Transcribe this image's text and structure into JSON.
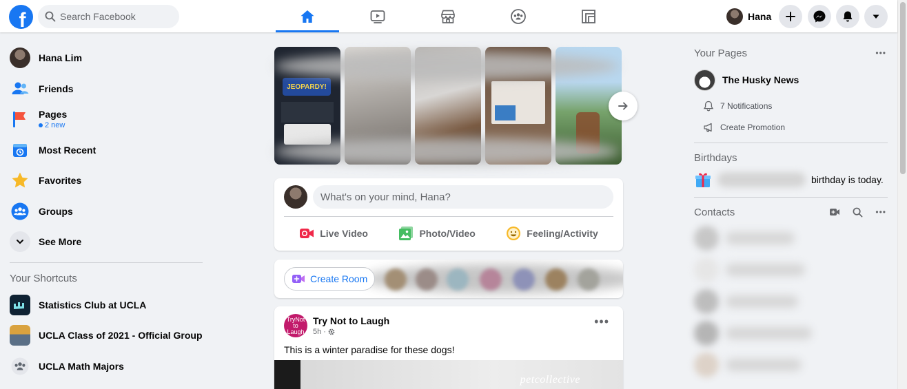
{
  "topbar": {
    "logo": "f",
    "search_placeholder": "Search Facebook",
    "tabs": [
      {
        "name": "home",
        "icon": "home-icon",
        "active": true
      },
      {
        "name": "watch",
        "icon": "video-icon",
        "active": false
      },
      {
        "name": "marketplace",
        "icon": "store-icon",
        "active": false
      },
      {
        "name": "groups",
        "icon": "groups-icon",
        "active": false
      },
      {
        "name": "gaming",
        "icon": "gaming-icon",
        "active": false
      }
    ],
    "profile_name": "Hana",
    "buttons": [
      "plus-icon",
      "messenger-icon",
      "bell-icon",
      "caret-down-icon"
    ]
  },
  "left_nav": {
    "items": [
      {
        "label": "Hana Lim",
        "icon": "avatar"
      },
      {
        "label": "Friends",
        "icon": "friends-icon"
      },
      {
        "label": "Pages",
        "icon": "pages-flag-icon",
        "sub": "2 new"
      },
      {
        "label": "Most Recent",
        "icon": "clock-calendar-icon"
      },
      {
        "label": "Favorites",
        "icon": "star-icon"
      },
      {
        "label": "Groups",
        "icon": "groups-icon"
      },
      {
        "label": "See More",
        "icon": "chevron-down-icon"
      }
    ],
    "shortcuts_title": "Your Shortcuts",
    "shortcuts": [
      {
        "label": "Statistics Club at UCLA"
      },
      {
        "label": "UCLA Class of 2021 - Official Group"
      },
      {
        "label": "UCLA Math Majors"
      }
    ]
  },
  "stories": {
    "cards": [
      {
        "caption": "JEOPARDY!",
        "bg": "#1f2530"
      },
      {
        "bg": "#a9a5a0"
      },
      {
        "bg": "#8e8a86"
      },
      {
        "bg": "#6c5a4a"
      },
      {
        "bg": "#5b7a5a"
      }
    ],
    "next_icon": "arrow-right-icon"
  },
  "composer": {
    "placeholder": "What's on your mind, Hana?",
    "actions": [
      {
        "label": "Live Video",
        "icon": "live-video-icon",
        "color": "#f02849"
      },
      {
        "label": "Photo/Video",
        "icon": "photo-icon",
        "color": "#45bd62"
      },
      {
        "label": "Feeling/Activity",
        "icon": "smiley-icon",
        "color": "#f7b928"
      }
    ]
  },
  "rooms": {
    "create_label": "Create Room"
  },
  "post": {
    "author": "Try Not to Laugh",
    "avatar_text": "TryNot to Laugh",
    "time": "5h",
    "text": "This is a winter paradise for these dogs!",
    "watermark": "petcollective"
  },
  "right": {
    "pages_title": "Your Pages",
    "page_name": "The Husky News",
    "notifications": "7 Notifications",
    "create_promotion": "Create Promotion",
    "birthdays_title": "Birthdays",
    "birthday_text": "birthday is today.",
    "contacts_title": "Contacts"
  },
  "colors": {
    "accent": "#1877f2",
    "bg": "#f0f2f5"
  }
}
